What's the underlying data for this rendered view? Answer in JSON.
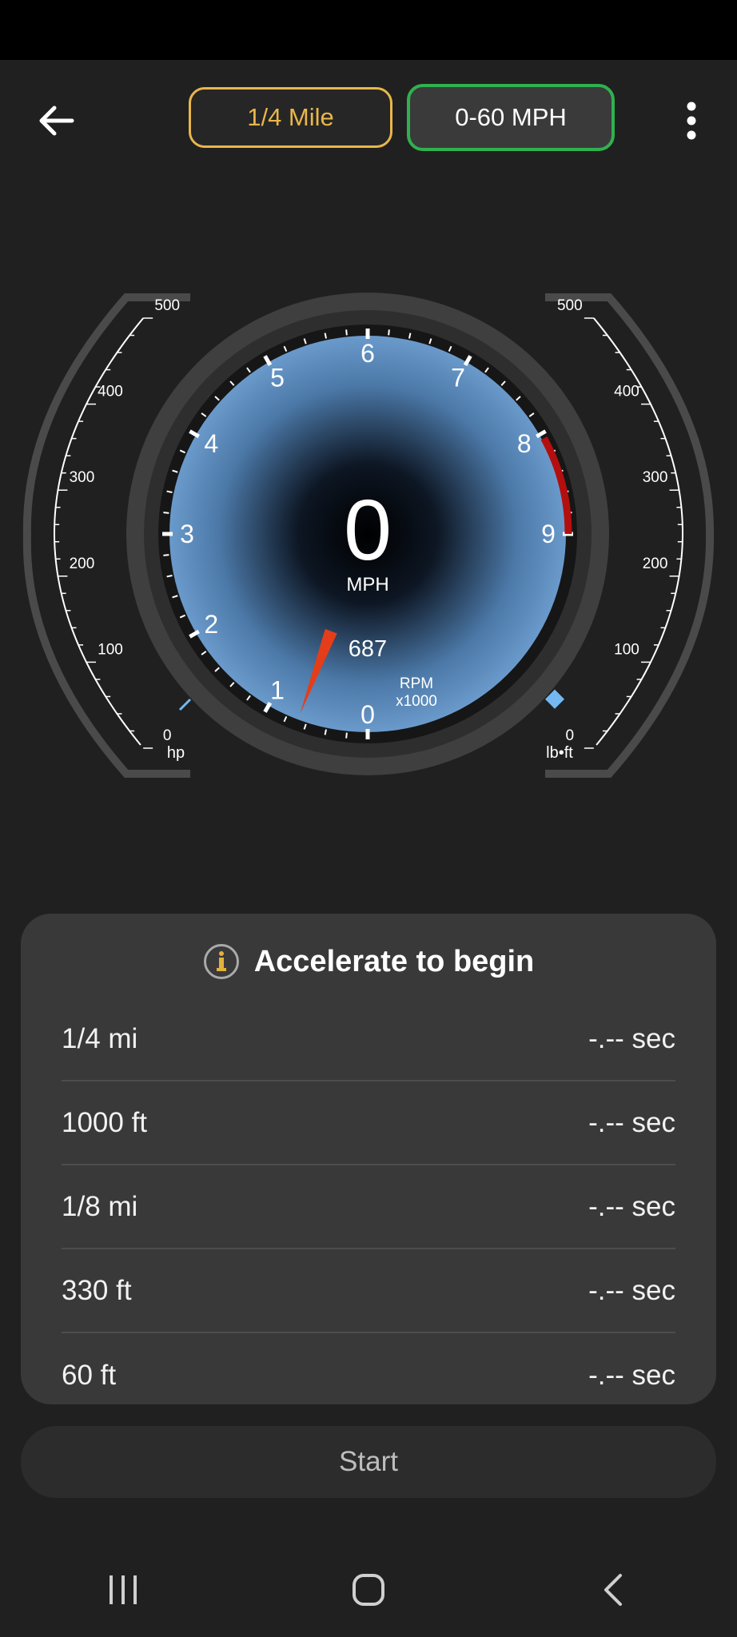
{
  "modes": {
    "quarter_mile": "1/4 Mile",
    "zero_sixty": "0-60 MPH"
  },
  "gauge": {
    "speed_value": "0",
    "speed_unit": "MPH",
    "rpm_value": "687",
    "rpm_label": "RPM",
    "rpm_multiplier": "x1000",
    "rpm_ticks": [
      "0",
      "1",
      "2",
      "3",
      "4",
      "5",
      "6",
      "7",
      "8",
      "9"
    ],
    "rpm_max": 9,
    "rpm_current": 0.687,
    "redline_start": 8,
    "hp_unit": "hp",
    "hp_ticks": [
      "0",
      "100",
      "200",
      "300",
      "400",
      "500"
    ],
    "torque_unit": "lb•ft",
    "torque_ticks": [
      "0",
      "100",
      "200",
      "300",
      "400",
      "500"
    ],
    "needle_color": "#e43d1a",
    "redline_color": "#b30f0f",
    "hp_marker_color": "#74b8f3"
  },
  "panel": {
    "title": "Accelerate to begin",
    "rows": [
      {
        "label": "1/4 mi",
        "value": "-.-- sec"
      },
      {
        "label": "1000 ft",
        "value": "-.-- sec"
      },
      {
        "label": "1/8 mi",
        "value": "-.-- sec"
      },
      {
        "label": "330 ft",
        "value": "-.-- sec"
      },
      {
        "label": "60 ft",
        "value": "-.-- sec"
      }
    ]
  },
  "start_label": "Start",
  "icons": {
    "back": "arrow-left-icon",
    "menu": "more-vertical-icon",
    "info": "info-icon",
    "nav_recents": "recents-icon",
    "nav_home": "home-icon",
    "nav_back": "chevron-left-icon"
  }
}
